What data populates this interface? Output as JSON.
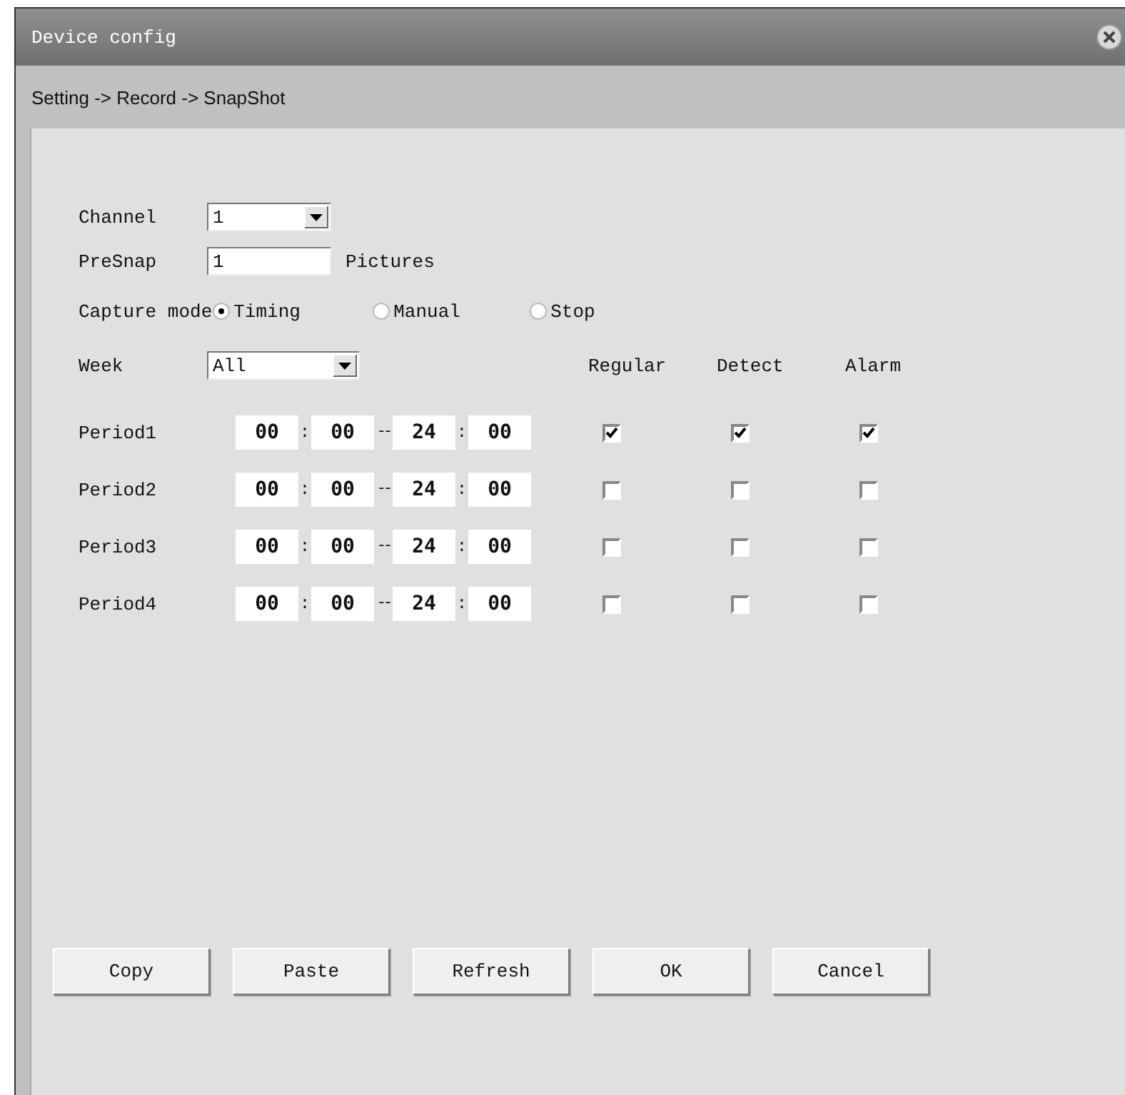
{
  "window": {
    "title": "Device config"
  },
  "breadcrumb": "Setting -> Record -> SnapShot",
  "channel": {
    "label": "Channel",
    "value": "1"
  },
  "presnap": {
    "label": "PreSnap",
    "value": "1",
    "unit": "Pictures"
  },
  "capture_mode": {
    "label": "Capture mode",
    "options": [
      {
        "label": "Timing",
        "selected": true
      },
      {
        "label": "Manual",
        "selected": false
      },
      {
        "label": "Stop",
        "selected": false
      }
    ]
  },
  "week": {
    "label": "Week",
    "value": "All"
  },
  "columns": [
    "Regular",
    "Detect",
    "Alarm"
  ],
  "periods": [
    {
      "label": "Period1",
      "times": [
        "00",
        "00",
        "24",
        "00"
      ],
      "separators": [
        ":",
        "--",
        ":"
      ],
      "checks": [
        {
          "checked": true
        },
        {
          "checked": true
        },
        {
          "checked": true
        }
      ]
    },
    {
      "label": "Period2",
      "times": [
        "00",
        "00",
        "24",
        "00"
      ],
      "separators": [
        ":",
        "--",
        ":"
      ],
      "checks": [
        {
          "checked": false
        },
        {
          "checked": false
        },
        {
          "checked": false
        }
      ]
    },
    {
      "label": "Period3",
      "times": [
        "00",
        "00",
        "24",
        "00"
      ],
      "separators": [
        ":",
        "--",
        ":"
      ],
      "checks": [
        {
          "checked": false
        },
        {
          "checked": false
        },
        {
          "checked": false
        }
      ]
    },
    {
      "label": "Period4",
      "times": [
        "00",
        "00",
        "24",
        "00"
      ],
      "separators": [
        ":",
        "--",
        ":"
      ],
      "checks": [
        {
          "checked": false
        },
        {
          "checked": false
        },
        {
          "checked": false
        }
      ]
    }
  ],
  "buttons": [
    "Copy",
    "Paste",
    "Refresh",
    "OK",
    "Cancel"
  ]
}
